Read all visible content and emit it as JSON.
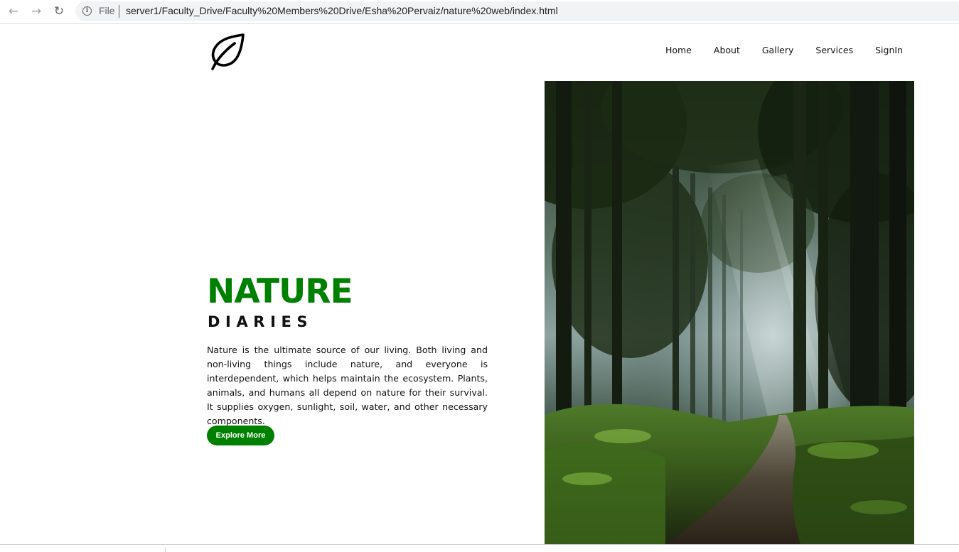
{
  "browser": {
    "back_icon": "arrow-left-icon",
    "forward_icon": "arrow-right-icon",
    "reload_icon": "reload-icon",
    "info_icon": "info-icon",
    "scheme_label": "File",
    "url": "server1/Faculty_Drive/Faculty%20Members%20Drive/Esha%20Pervaiz/nature%20web/index.html"
  },
  "site": {
    "logo_icon": "leaf-icon",
    "nav": {
      "home": "Home",
      "about": "About",
      "gallery": "Gallery",
      "services": "Services",
      "signin": "SignIn"
    },
    "hero": {
      "title": "NATURE",
      "subtitle": "DIARIES",
      "description": "Nature is the ultimate source of our living. Both living and non-living things include nature, and everyone is interdependent, which helps maintain the ecosystem. Plants, animals, and humans all depend on nature for their survival. It supplies oxygen, sunlight, soil, water, and other necessary components.",
      "cta_label": "Explore More",
      "image": "forest-path-photo"
    }
  },
  "colors": {
    "brand_green": "#008000",
    "text_dark": "#111111",
    "button_text": "#ffffff"
  }
}
